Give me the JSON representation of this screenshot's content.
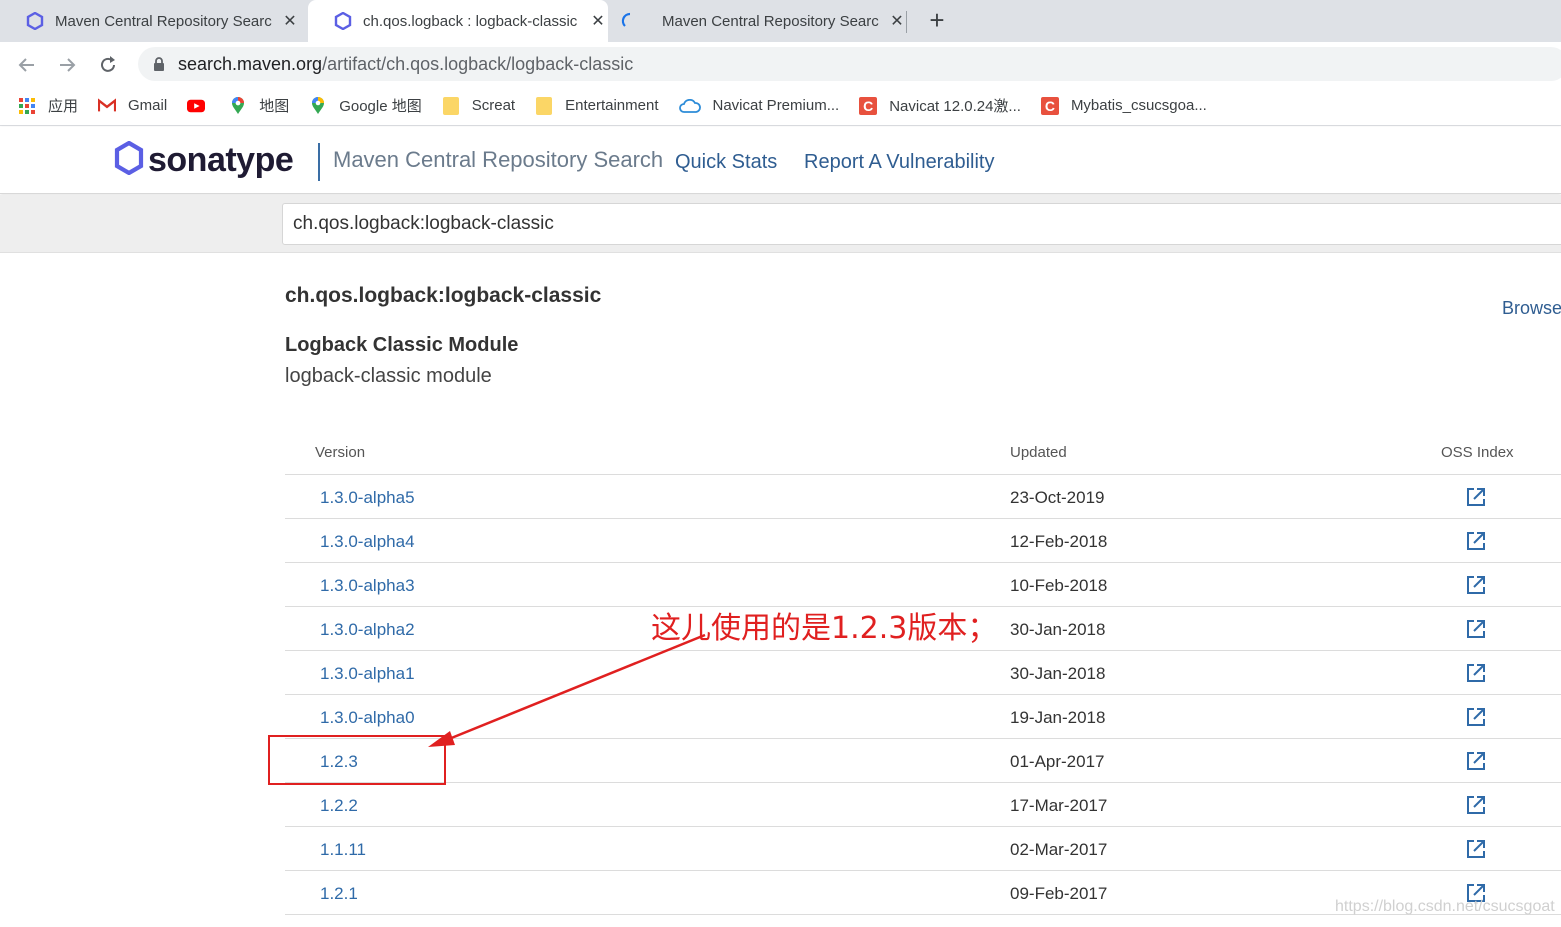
{
  "browser": {
    "tabs": [
      {
        "title": "Maven Central Repository Search",
        "icon": "sonatype-hex-icon",
        "active": false
      },
      {
        "title": "ch.qos.logback : logback-classic",
        "icon": "sonatype-hex-icon",
        "active": true
      },
      {
        "title": "Maven Central Repository Search",
        "icon": "loading-spinner-icon",
        "active": false
      }
    ],
    "url_host": "search.maven.org",
    "url_path": "/artifact/ch.qos.logback/logback-classic",
    "bookmarks": [
      {
        "label": "应用",
        "icon": "apps-grid-icon"
      },
      {
        "label": "Gmail",
        "icon": "gmail-icon"
      },
      {
        "label": "",
        "icon": "youtube-icon"
      },
      {
        "label": "地图",
        "icon": "maps-pin-icon"
      },
      {
        "label": "Google 地图",
        "icon": "maps-pin-icon"
      },
      {
        "label": "Screat",
        "icon": "folder-icon"
      },
      {
        "label": "Entertainment",
        "icon": "folder-icon"
      },
      {
        "label": "Navicat Premium...",
        "icon": "cloud-icon"
      },
      {
        "label": "Navicat 12.0.24激...",
        "icon": "csdn-icon"
      },
      {
        "label": "Mybatis_csucsgoa...",
        "icon": "csdn-icon"
      }
    ]
  },
  "header": {
    "logo_text": "sonatype",
    "site_title": "Maven Central Repository Search",
    "nav": [
      "Quick Stats",
      "Report A Vulnerability"
    ]
  },
  "search": {
    "value": "ch.qos.logback:logback-classic"
  },
  "artifact": {
    "title": "ch.qos.logback:logback-classic",
    "browse_label": "Browse",
    "module_name": "Logback Classic Module",
    "module_desc": "logback-classic module"
  },
  "table": {
    "headers": {
      "version": "Version",
      "updated": "Updated",
      "oss": "OSS Index"
    },
    "rows": [
      {
        "version": "1.3.0-alpha5",
        "updated": "23-Oct-2019"
      },
      {
        "version": "1.3.0-alpha4",
        "updated": "12-Feb-2018"
      },
      {
        "version": "1.3.0-alpha3",
        "updated": "10-Feb-2018"
      },
      {
        "version": "1.3.0-alpha2",
        "updated": "30-Jan-2018"
      },
      {
        "version": "1.3.0-alpha1",
        "updated": "30-Jan-2018"
      },
      {
        "version": "1.3.0-alpha0",
        "updated": "19-Jan-2018"
      },
      {
        "version": "1.2.3",
        "updated": "01-Apr-2017"
      },
      {
        "version": "1.2.2",
        "updated": "17-Mar-2017"
      },
      {
        "version": "1.1.11",
        "updated": "02-Mar-2017"
      },
      {
        "version": "1.2.1",
        "updated": "09-Feb-2017"
      }
    ]
  },
  "annotation": {
    "text": "这儿使用的是1.2.3版本；",
    "color": "#e02020"
  },
  "watermark": "https://blog.csdn.net/csucsgoat",
  "colors": {
    "link": "#2f6aa8",
    "header_nav": "#2f5d91",
    "logo_hex": "#5b5fe4"
  }
}
